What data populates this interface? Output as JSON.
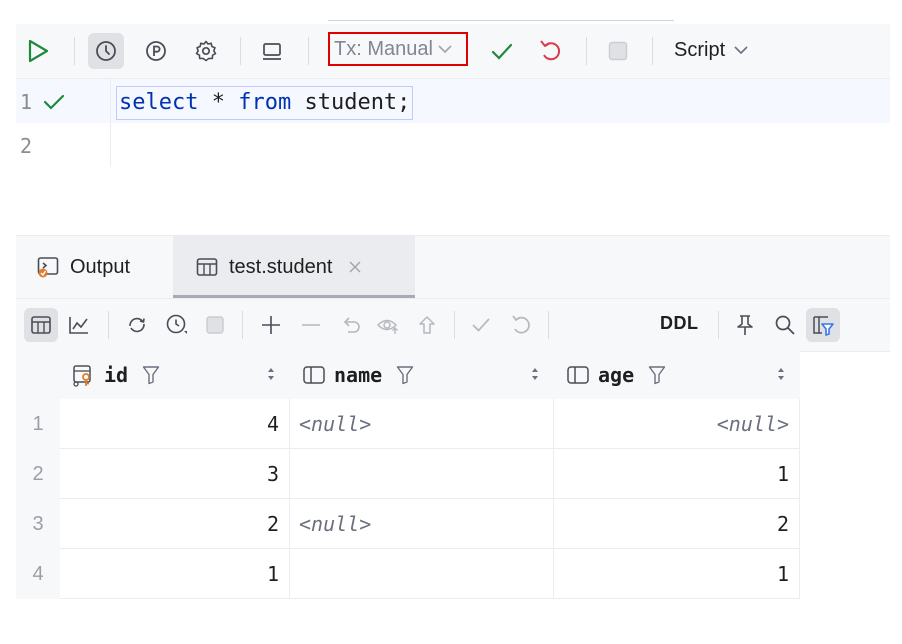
{
  "toolbar": {
    "tx_mode": "Tx: Manual",
    "script_label": "Script"
  },
  "editor": {
    "lines": [
      {
        "number": "1",
        "status": "check-icon"
      },
      {
        "number": "2"
      }
    ],
    "code": {
      "kw1": "select",
      "mid": " * ",
      "kw2": "from",
      "rest": " student;"
    }
  },
  "results": {
    "tabs": [
      {
        "label": "Output",
        "icon": "output-console-icon"
      },
      {
        "label": "test.student",
        "icon": "table-icon",
        "active": true
      }
    ],
    "toolbar": {
      "ddl_label": "DDL"
    },
    "columns": [
      {
        "name": "id",
        "icon": "primary-key-column-icon"
      },
      {
        "name": "name",
        "icon": "column-icon"
      },
      {
        "name": "age",
        "icon": "column-icon"
      }
    ],
    "rows": [
      {
        "rownum": "1",
        "id": "4",
        "name": "<null>",
        "age": "<null>"
      },
      {
        "rownum": "2",
        "id": "3",
        "name": "",
        "age": "1"
      },
      {
        "rownum": "3",
        "id": "2",
        "name": "<null>",
        "age": "2"
      },
      {
        "rownum": "4",
        "id": "1",
        "name": "",
        "age": "1"
      }
    ]
  },
  "colors": {
    "keyword": "#0033b3",
    "run_green": "#208a3c",
    "rollback_red": "#db3b4b",
    "tx_highlight": "#e00000",
    "accent_blue": "#3574f0"
  }
}
